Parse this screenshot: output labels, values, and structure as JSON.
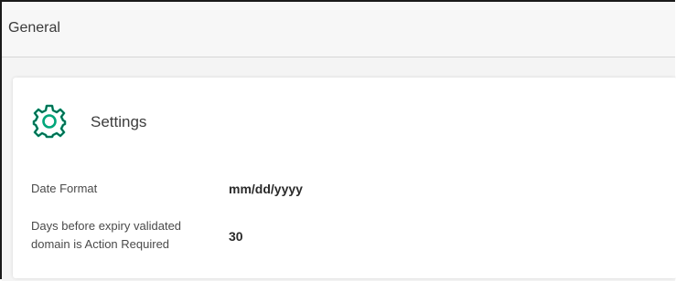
{
  "header": {
    "title": "General"
  },
  "settings": {
    "title": "Settings",
    "icon": "gear-icon",
    "icon_color": "#00a67a",
    "fields": [
      {
        "label": "Date Format",
        "value": "mm/dd/yyyy"
      },
      {
        "label_line1": "Days before expiry validated",
        "label_line2": "domain is Action Required",
        "value": "30"
      }
    ]
  }
}
